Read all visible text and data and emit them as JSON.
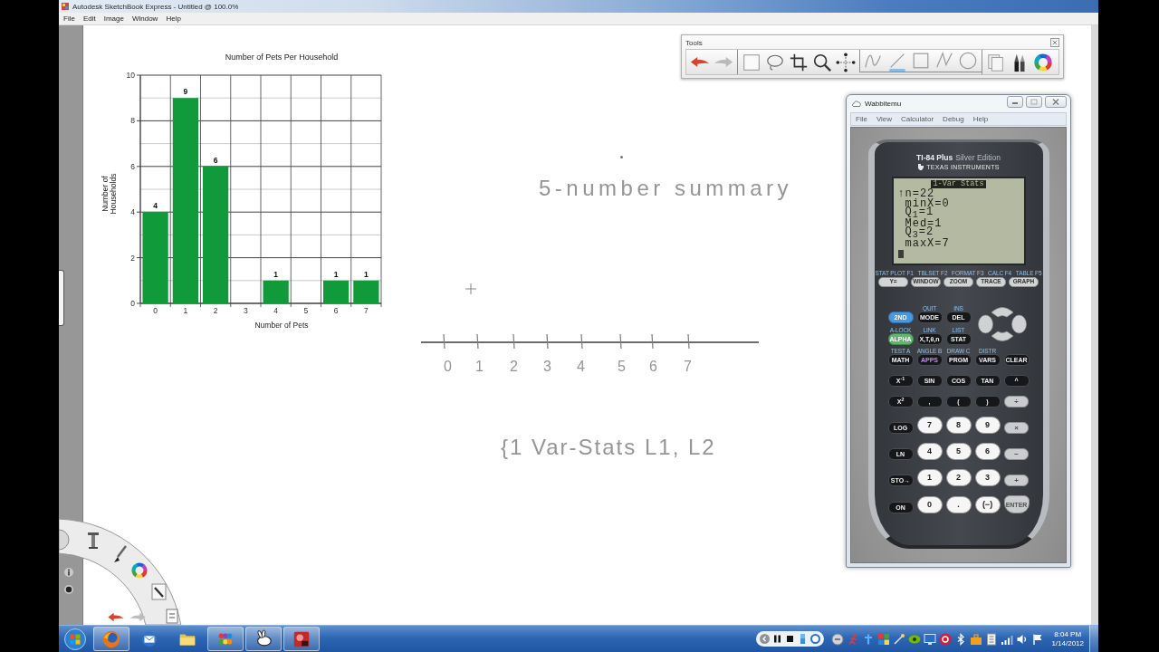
{
  "window": {
    "title": "Autodesk SketchBook Express - Untitled @ 100.0%",
    "menu": [
      "File",
      "Edit",
      "Image",
      "Window",
      "Help"
    ]
  },
  "chart": {
    "chart_data": {
      "type": "bar",
      "title": "Number of Pets Per Household",
      "xlabel": "Number of Pets",
      "ylabel": "Number of Households",
      "categories": [
        "0",
        "1",
        "2",
        "3",
        "4",
        "5",
        "6",
        "7"
      ],
      "series": [
        {
          "color": "#119a3a",
          "values": [
            4,
            9,
            6,
            0,
            1,
            0,
            1,
            1
          ]
        }
      ],
      "ylim": [
        0,
        10
      ],
      "yticks": [
        0,
        2,
        4,
        6,
        8,
        10
      ],
      "grid": true,
      "value_labels": [
        "4",
        "9",
        "6",
        null,
        "1",
        null,
        "1",
        "1"
      ]
    }
  },
  "sketch": {
    "heading": "5-number summary",
    "number_line": {
      "labels": [
        "0",
        "1",
        "2",
        "3",
        "4",
        "5",
        "6",
        "7"
      ]
    },
    "note": "{1 Var-Stats L1, L2"
  },
  "tools_palette": {
    "title": "Tools",
    "shape_tools": [
      {
        "kind": "curve",
        "selected": false
      },
      {
        "kind": "line",
        "selected": true
      },
      {
        "kind": "rectangle",
        "selected": false
      },
      {
        "kind": "polyline",
        "selected": false
      },
      {
        "kind": "ellipse",
        "selected": false
      }
    ]
  },
  "calculator_window": {
    "title": "Wabbitemu",
    "menu": [
      "File",
      "View",
      "Calculator",
      "Debug",
      "Help"
    ],
    "model": "TI-84 Plus",
    "edition": "Silver Edition",
    "maker": "TEXAS INSTRUMENTS",
    "screen": {
      "header": "1-Var Stats",
      "scroll_mark": "↑",
      "lines": [
        "n=22",
        "minX=0",
        "Q$_{1}$=1",
        "Med=1",
        "Q$_{3}$=2",
        "maxX=7"
      ]
    },
    "function_keys": [
      {
        "label": "Y=",
        "above": "STAT PLOT F1"
      },
      {
        "label": "WINDOW",
        "above": "TBLSET F2"
      },
      {
        "label": "ZOOM",
        "above": "FORMAT F3"
      },
      {
        "label": "TRACE",
        "above": "CALC F4"
      },
      {
        "label": "GRAPH",
        "above": "TABLE F5"
      }
    ],
    "keys": [
      {
        "label": "2ND",
        "kind": "second"
      },
      {
        "label": "MODE",
        "kind": "dark",
        "above": "QUIT"
      },
      {
        "label": "DEL",
        "kind": "dark",
        "above": "INS"
      },
      {
        "label": "ALPHA",
        "kind": "alpha",
        "above": "A-LOCK"
      },
      {
        "label": "X,T,θ,n",
        "kind": "dark",
        "above": "LINK"
      },
      {
        "label": "STAT",
        "kind": "dark",
        "above": "LIST"
      },
      {
        "label": "MATH",
        "kind": "dark",
        "above": "TEST A"
      },
      {
        "label": "APPS",
        "kind": "accent",
        "above": "ANGLE B"
      },
      {
        "label": "PRGM",
        "kind": "dark",
        "above": "DRAW C"
      },
      {
        "label": "VARS",
        "kind": "dark",
        "above": "DISTR"
      },
      {
        "label": "CLEAR",
        "kind": "dark"
      },
      {
        "label": "X$^{-1}$",
        "kind": "dark"
      },
      {
        "label": "SIN",
        "kind": "dark"
      },
      {
        "label": "COS",
        "kind": "dark"
      },
      {
        "label": "TAN",
        "kind": "dark"
      },
      {
        "label": "^",
        "kind": "dark"
      },
      {
        "label": "X$^{2}$",
        "kind": "dark"
      },
      {
        "label": ",",
        "kind": "dark"
      },
      {
        "label": "(",
        "kind": "dark"
      },
      {
        "label": ")",
        "kind": "dark"
      },
      {
        "label": "÷",
        "kind": "light"
      },
      {
        "label": "LOG",
        "kind": "dark"
      },
      {
        "label": "7",
        "kind": "number"
      },
      {
        "label": "8",
        "kind": "number"
      },
      {
        "label": "9",
        "kind": "number"
      },
      {
        "label": "×",
        "kind": "light"
      },
      {
        "label": "LN",
        "kind": "dark"
      },
      {
        "label": "4",
        "kind": "number"
      },
      {
        "label": "5",
        "kind": "number"
      },
      {
        "label": "6",
        "kind": "number"
      },
      {
        "label": "−",
        "kind": "light"
      },
      {
        "label": "STO→",
        "kind": "dark"
      },
      {
        "label": "1",
        "kind": "number"
      },
      {
        "label": "2",
        "kind": "number"
      },
      {
        "label": "3",
        "kind": "number"
      },
      {
        "label": "+",
        "kind": "light"
      },
      {
        "label": "ON",
        "kind": "dark"
      },
      {
        "label": "0",
        "kind": "number"
      },
      {
        "label": ".",
        "kind": "number"
      },
      {
        "label": "(−)",
        "kind": "number"
      },
      {
        "label": "ENTER",
        "kind": "enter"
      }
    ]
  },
  "taskbar": {
    "apps": [
      {
        "kind": "browser",
        "running": true
      },
      {
        "kind": "mail",
        "running": false
      },
      {
        "kind": "folder",
        "running": false
      },
      {
        "kind": "palette",
        "running": true
      },
      {
        "kind": "rabbit",
        "running": true
      },
      {
        "kind": "media",
        "running": true
      }
    ],
    "clock": {
      "time": "8:04 PM",
      "date": "1/14/2012"
    }
  }
}
